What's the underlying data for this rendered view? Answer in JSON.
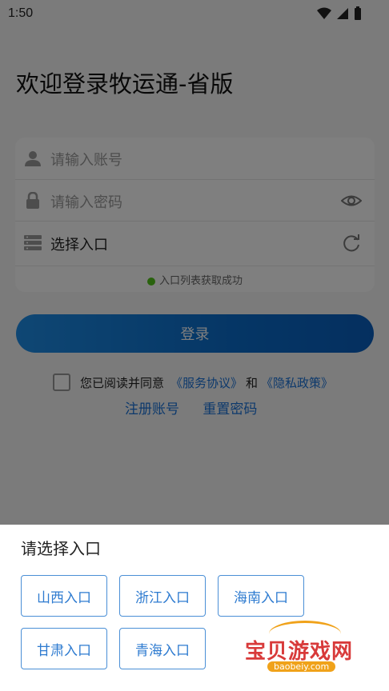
{
  "status_bar": {
    "time": "1:50"
  },
  "welcome_title": "欢迎登录牧运通-省版",
  "form": {
    "account_placeholder": "请输入账号",
    "password_placeholder": "请输入密码",
    "entry_placeholder": "选择入口",
    "entry_status": "入口列表获取成功"
  },
  "login_button": "登录",
  "agreement": {
    "prefix": "您已阅读并同意",
    "service": "《服务协议》",
    "and": "和",
    "privacy": "《隐私政策》"
  },
  "links": {
    "register": "注册账号",
    "reset": "重置密码"
  },
  "sheet": {
    "title": "请选择入口",
    "options": [
      "山西入口",
      "浙江入口",
      "海南入口",
      "甘肃入口",
      "青海入口"
    ]
  },
  "watermark": {
    "brand": "宝贝游戏网",
    "site": "baobeiy.com"
  },
  "colors": {
    "accent": "#1a73d9",
    "button": "#0b6dcc",
    "success": "#52c41a"
  }
}
